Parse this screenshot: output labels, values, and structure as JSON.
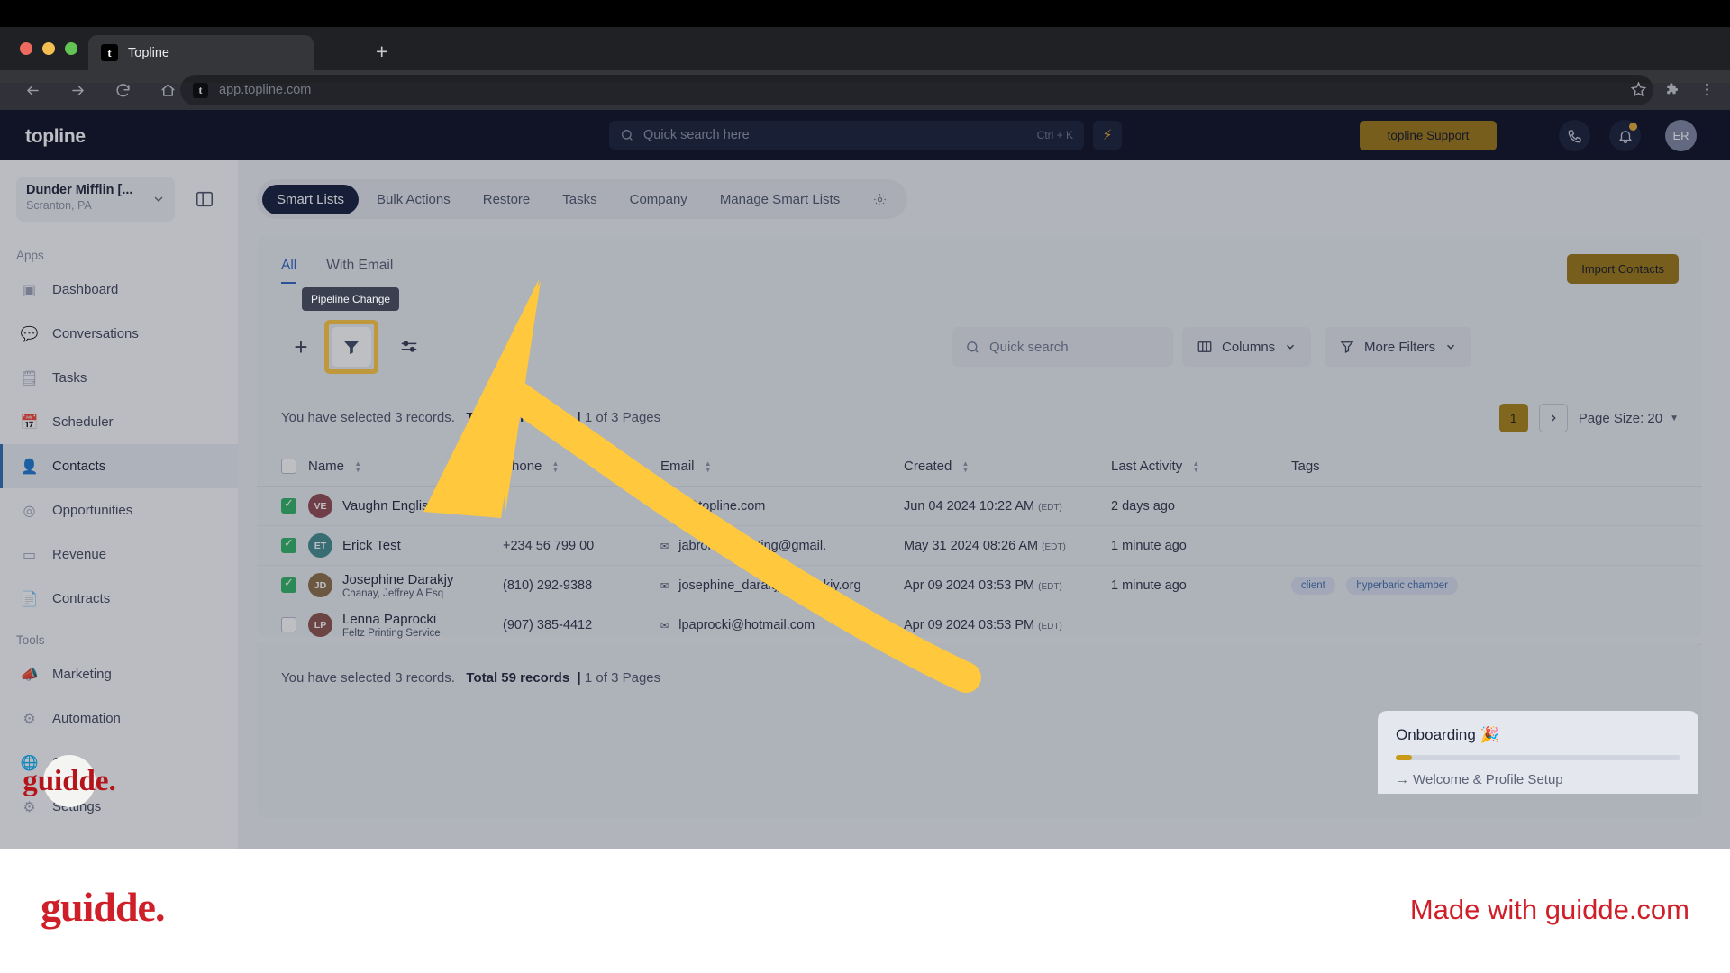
{
  "browser": {
    "tab_title": "Topline",
    "favicon_letter": "t",
    "url": "app.topline.com",
    "new_tab_label": "+"
  },
  "appbar": {
    "brand": "topline",
    "search_placeholder": "Quick search here",
    "search_shortcut": "Ctrl + K",
    "bolt_icon": "lightning-icon",
    "support_label": "topline Support",
    "avatar_initials": "ER"
  },
  "sidebar": {
    "org_name": "Dunder Mifflin [...",
    "org_location": "Scranton, PA",
    "sections": [
      {
        "label": "Apps",
        "items": [
          {
            "label": "Dashboard",
            "icon": "dashboard-icon",
            "active": false
          },
          {
            "label": "Conversations",
            "icon": "conversations-icon",
            "active": false
          },
          {
            "label": "Tasks",
            "icon": "tasks-icon",
            "active": false
          },
          {
            "label": "Scheduler",
            "icon": "calendar-icon",
            "active": false
          },
          {
            "label": "Contacts",
            "icon": "contacts-icon",
            "active": true
          },
          {
            "label": "Opportunities",
            "icon": "target-icon",
            "active": false
          },
          {
            "label": "Revenue",
            "icon": "card-icon",
            "active": false
          },
          {
            "label": "Contracts",
            "icon": "contract-icon",
            "active": false
          }
        ]
      },
      {
        "label": "Tools",
        "items": [
          {
            "label": "Marketing",
            "icon": "megaphone-icon",
            "active": false
          },
          {
            "label": "Automation",
            "icon": "gears-icon",
            "active": false
          },
          {
            "label": "Sites",
            "icon": "globe-icon",
            "active": false
          },
          {
            "label": "Settings",
            "icon": "gear-icon",
            "active": false
          }
        ]
      }
    ]
  },
  "tabs": [
    {
      "label": "Smart Lists",
      "active": true
    },
    {
      "label": "Bulk Actions",
      "active": false
    },
    {
      "label": "Restore",
      "active": false
    },
    {
      "label": "Tasks",
      "active": false
    },
    {
      "label": "Company",
      "active": false
    },
    {
      "label": "Manage Smart Lists",
      "active": false
    }
  ],
  "subtabs": [
    {
      "label": "All",
      "active": true
    },
    {
      "label": "With Email",
      "active": false
    }
  ],
  "toolbar": {
    "import_label": "Import Contacts",
    "tooltip": "Pipeline Change",
    "add_icon": "plus-icon",
    "filter_icon": "funnel-icon",
    "settings_icon": "sliders-icon",
    "quick_search_placeholder": "Quick search",
    "columns_label": "Columns",
    "more_filters_label": "More Filters",
    "highlight_color": "#ffc83d"
  },
  "records": {
    "selected_text": "You have selected 3 records.",
    "total_text": "Total 59 records",
    "pages_text": "1 of 3 Pages",
    "page_number": "1",
    "page_size_label": "Page Size: 20"
  },
  "table": {
    "columns": [
      "Name",
      "Phone",
      "Email",
      "Created",
      "Last Activity",
      "Tags"
    ],
    "rows": [
      {
        "checked": true,
        "initials": "VE",
        "avatar_color": "#8e4750",
        "name": "Vaughn English",
        "subname": "",
        "phone": "",
        "email": "v@topline.com",
        "created": "Jun 04 2024 10:22 AM",
        "tz": "(EDT)",
        "last_activity": "2 days ago",
        "tags": []
      },
      {
        "checked": true,
        "initials": "ET",
        "avatar_color": "#3f8a8f",
        "name": "Erick Test",
        "subname": "",
        "phone": "+234 56 799 00",
        "email": "jabronipiebeating@gmail.",
        "created": "May 31 2024 08:26 AM",
        "tz": "(EDT)",
        "last_activity": "1 minute ago",
        "tags": []
      },
      {
        "checked": true,
        "initials": "JD",
        "avatar_color": "#8a6a46",
        "name": "Josephine Darakjy",
        "subname": "Chanay, Jeffrey A Esq",
        "phone": "(810) 292-9388",
        "email": "josephine_darakjy@darakjy.org",
        "created": "Apr 09 2024 03:53 PM",
        "tz": "(EDT)",
        "last_activity": "1 minute ago",
        "tags": [
          "client",
          "hyperbaric chamber"
        ]
      },
      {
        "checked": false,
        "initials": "LP",
        "avatar_color": "#8c4f4a",
        "name": "Lenna Paprocki",
        "subname": "Feltz Printing Service",
        "phone": "(907) 385-4412",
        "email": "lpaprocki@hotmail.com",
        "created": "Apr 09 2024 03:53 PM",
        "tz": "(EDT)",
        "last_activity": "",
        "tags": []
      }
    ]
  },
  "onboarding": {
    "title": "Onboarding 🎉",
    "step_label": "→ Welcome & Profile Setup",
    "progress_pct": 5
  },
  "footer": {
    "logo": "guidde.",
    "made_with": "Made with guidde.com"
  }
}
